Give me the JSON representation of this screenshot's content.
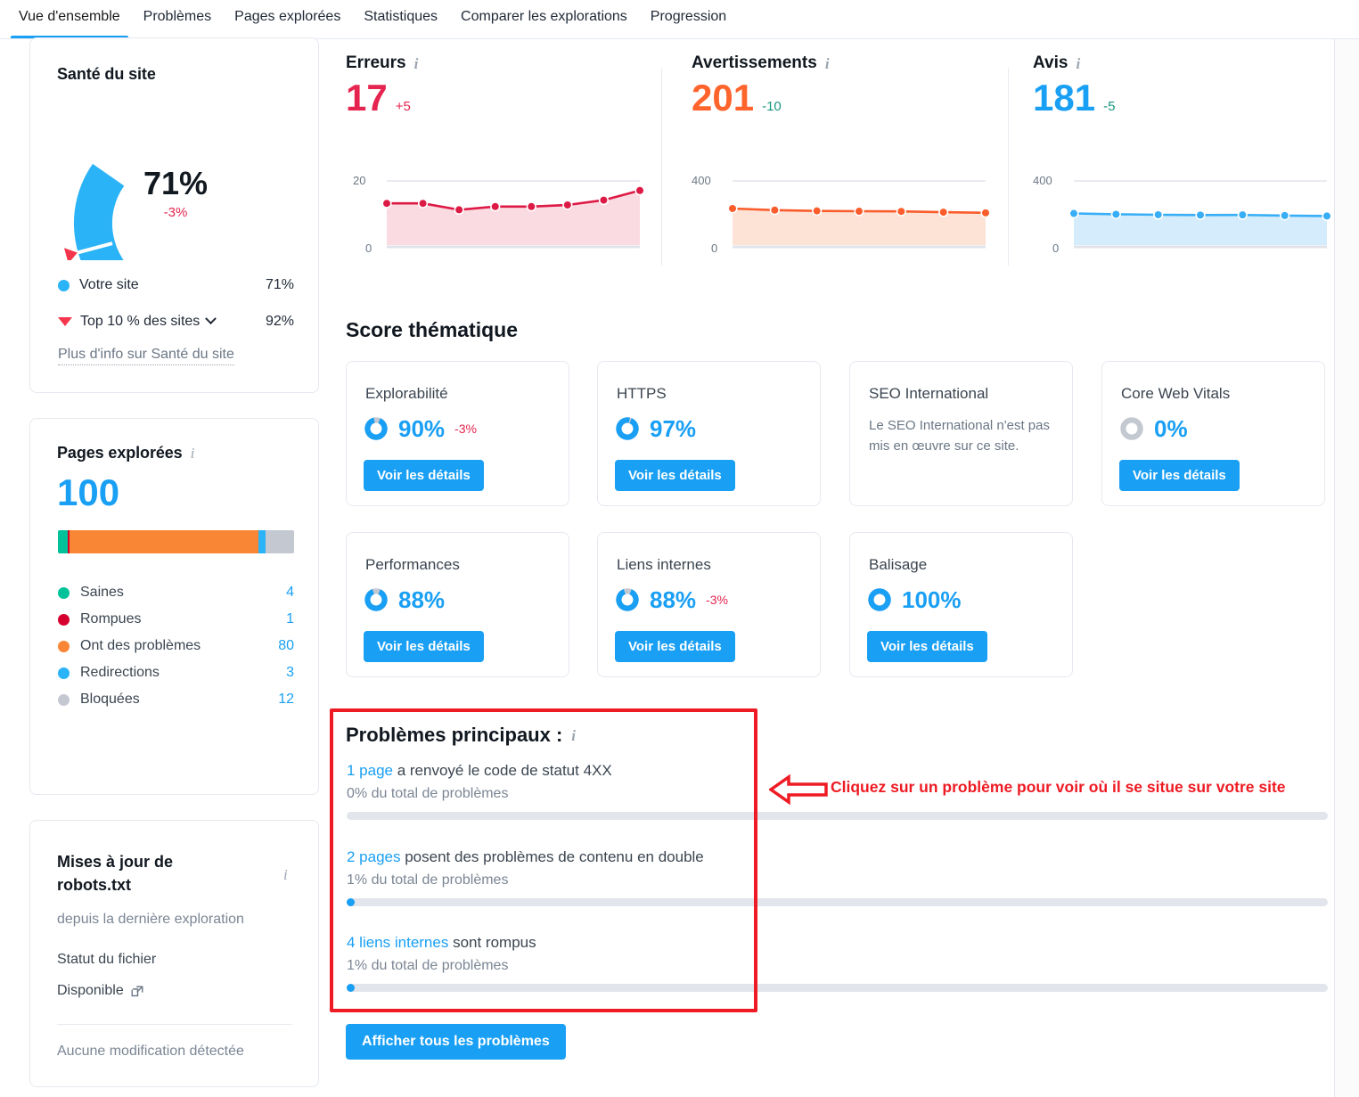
{
  "tabs": [
    {
      "label": "Vue d'ensemble",
      "active": true
    },
    {
      "label": "Problèmes",
      "active": false
    },
    {
      "label": "Pages explorées",
      "active": false
    },
    {
      "label": "Statistiques",
      "active": false
    },
    {
      "label": "Comparer les explorations",
      "active": false
    },
    {
      "label": "Progression",
      "active": false
    }
  ],
  "site_health": {
    "title": "Santé du site",
    "value": "71%",
    "delta": "-3%",
    "gauge_percent": 71,
    "benchmark_percent": 92,
    "legend": [
      {
        "label": "Votre site",
        "value": "71%",
        "color": "#2ab3f6",
        "marker": "dot"
      },
      {
        "label": "Top 10 % des sites",
        "value": "92%",
        "color": "#f4364c",
        "marker": "triangle",
        "has_dropdown": true
      }
    ],
    "more_info": "Plus d'info sur Santé du site"
  },
  "crawled_pages": {
    "title": "Pages explorées",
    "total": "100",
    "legend": [
      {
        "label": "Saines",
        "value": "4",
        "count": 4,
        "color": "#00c29a"
      },
      {
        "label": "Rompues",
        "value": "1",
        "count": 1,
        "color": "#d5002e"
      },
      {
        "label": "Ont des problèmes",
        "value": "80",
        "count": 80,
        "color": "#f98634"
      },
      {
        "label": "Redirections",
        "value": "3",
        "count": 3,
        "color": "#2ab3f6"
      },
      {
        "label": "Bloquées",
        "value": "12",
        "count": 12,
        "color": "#c3c8d1"
      }
    ]
  },
  "robots": {
    "title": "Mises à jour de robots.txt",
    "subtitle": "depuis la dernière exploration",
    "status_label": "Statut du fichier",
    "status_value": "Disponible",
    "note": "Aucune modification détectée"
  },
  "metrics": [
    {
      "name": "Erreurs",
      "value": "17",
      "delta": "+5",
      "value_color": "#e5254f",
      "delta_color": "#e5254f",
      "line_color": "#dd1a45",
      "fill_color": "#fbdbe2",
      "chart_data": {
        "type": "area",
        "title": "Erreurs",
        "ylabel": "",
        "ylim": [
          0,
          20
        ],
        "ticks": [
          "0",
          "20"
        ],
        "values": [
          13,
          13,
          11,
          12,
          12,
          12.5,
          14,
          17
        ]
      }
    },
    {
      "name": "Avertissements",
      "value": "201",
      "delta": "-10",
      "value_color": "#ff642d",
      "delta_color": "#17967f",
      "line_color": "#fa5d2b",
      "fill_color": "#fde2d6",
      "chart_data": {
        "type": "area",
        "title": "Avertissements",
        "ylabel": "",
        "ylim": [
          0,
          400
        ],
        "ticks": [
          "0",
          "400"
        ],
        "values": [
          228,
          218,
          213,
          211,
          210,
          205,
          201
        ]
      }
    },
    {
      "name": "Avis",
      "value": "181",
      "delta": "-5",
      "value_color": "#199ff4",
      "delta_color": "#17967f",
      "line_color": "#37aef6",
      "fill_color": "#d4ecfb",
      "chart_data": {
        "type": "area",
        "title": "Avis",
        "ylabel": "",
        "ylim": [
          0,
          400
        ],
        "ticks": [
          "0",
          "400"
        ],
        "values": [
          197,
          192,
          189,
          187,
          188,
          184,
          181
        ]
      }
    }
  ],
  "thematic": {
    "title": "Score thématique",
    "button_label": "Voir les détails",
    "cards": [
      {
        "name": "Explorabilité",
        "percent": "90%",
        "ring": 90,
        "delta": "-3%",
        "has_button": true,
        "desc": null
      },
      {
        "name": "HTTPS",
        "percent": "97%",
        "ring": 97,
        "delta": null,
        "has_button": true,
        "desc": null
      },
      {
        "name": "SEO International",
        "percent": null,
        "ring": null,
        "delta": null,
        "has_button": false,
        "desc": "Le SEO International n'est pas mis en œuvre sur ce site."
      },
      {
        "name": "Core Web Vitals",
        "percent": "0%",
        "ring": 0,
        "delta": null,
        "has_button": true,
        "desc": null
      },
      {
        "name": "Performances",
        "percent": "88%",
        "ring": 88,
        "delta": null,
        "has_button": true,
        "desc": null
      },
      {
        "name": "Liens internes",
        "percent": "88%",
        "ring": 88,
        "delta": "-3%",
        "has_button": true,
        "desc": null
      },
      {
        "name": "Balisage",
        "percent": "100%",
        "ring": 100,
        "delta": null,
        "has_button": true,
        "desc": null
      }
    ]
  },
  "top_issues": {
    "title": "Problèmes principaux :",
    "items": [
      {
        "link": "1 page",
        "rest": " a renvoyé le code de statut 4XX",
        "share_label": "0% du total de problèmes",
        "share": 0
      },
      {
        "link": "2 pages",
        "rest": " posent des problèmes de contenu en double",
        "share_label": "1% du total de problèmes",
        "share": 1
      },
      {
        "link": "4 liens internes",
        "rest": " sont rompus",
        "share_label": "1% du total de problèmes",
        "share": 1
      }
    ],
    "show_all_label": "Afficher tous les problèmes"
  },
  "annotation": {
    "text": "Cliquez sur un problème pour voir où il se situe sur votre site",
    "color": "#ee1b24"
  }
}
